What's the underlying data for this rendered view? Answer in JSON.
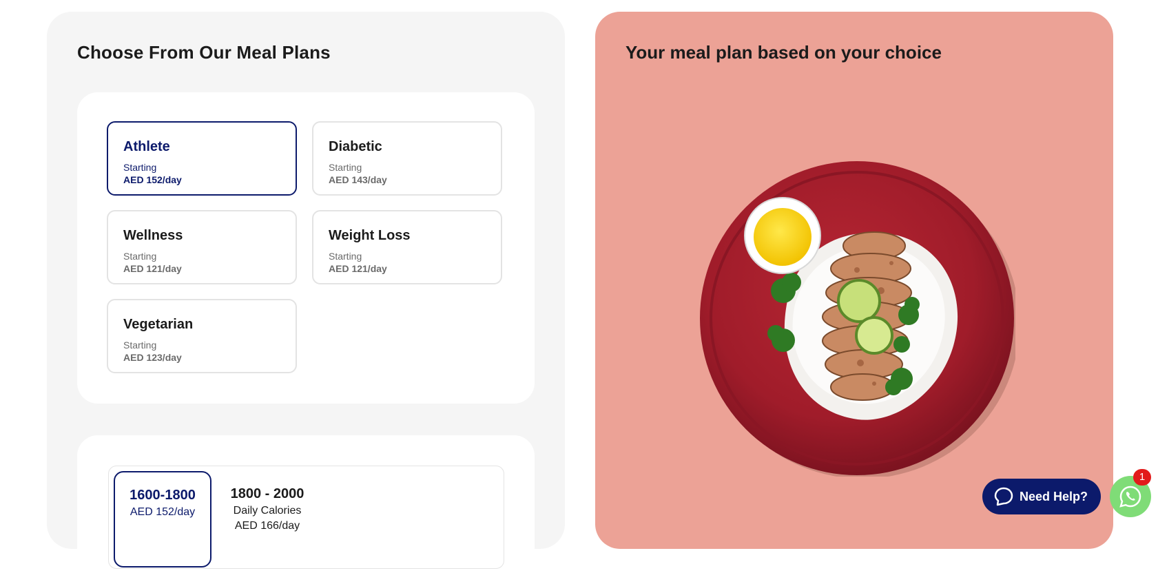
{
  "left": {
    "title": "Choose From Our Meal Plans",
    "plans": [
      {
        "name": "Athlete",
        "starting": "Starting",
        "price": "AED 152/day",
        "selected": true
      },
      {
        "name": "Diabetic",
        "starting": "Starting",
        "price": "AED 143/day",
        "selected": false
      },
      {
        "name": "Wellness",
        "starting": "Starting",
        "price": "AED 121/day",
        "selected": false
      },
      {
        "name": "Weight Loss",
        "starting": "Starting",
        "price": "AED 121/day",
        "selected": false
      },
      {
        "name": "Vegetarian",
        "starting": "Starting",
        "price": "AED 123/day",
        "selected": false
      }
    ],
    "calories": [
      {
        "range": "1600-1800",
        "line1": "AED 152/day",
        "selected": true
      },
      {
        "range": "1800 - 2000",
        "line1": "Daily Calories",
        "line2": "AED 166/day",
        "selected": false
      }
    ]
  },
  "right": {
    "title": "Your meal plan based on your choice"
  },
  "widgets": {
    "help_label": "Need Help?",
    "whatsapp_badge": "1"
  },
  "icons": {
    "chat": "chat-bubble-icon",
    "whatsapp": "whatsapp-icon"
  },
  "colors": {
    "accent": "#0c1a6b",
    "right_panel_bg": "#eca296",
    "whatsapp": "#7fdc77",
    "badge": "#e21b1b"
  }
}
